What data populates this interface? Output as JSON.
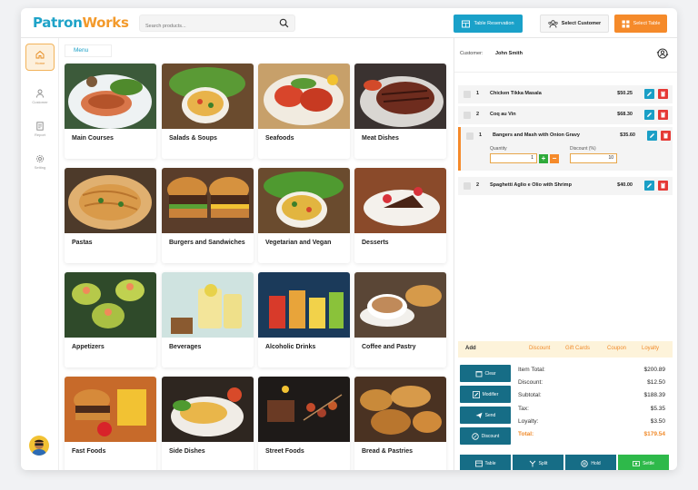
{
  "brand": {
    "part1": "Patron",
    "part2": "Works",
    "accent": "#1fa3c8",
    "accent2": "#f39a2b"
  },
  "search": {
    "placeholder": "Search products..."
  },
  "header": {
    "table_reservation": "Table Reservation",
    "select_customer": "Select Customer",
    "select_table": "Select Table"
  },
  "sidebar": {
    "items": [
      {
        "label": "Home",
        "icon": "home-icon",
        "active": true
      },
      {
        "label": "Customer",
        "icon": "user-icon"
      },
      {
        "label": "Report",
        "icon": "report-icon"
      },
      {
        "label": "Setting",
        "icon": "gear-icon"
      }
    ]
  },
  "menu_tab": "Menu",
  "categories": [
    {
      "label": "Main Courses"
    },
    {
      "label": "Salads & Soups"
    },
    {
      "label": "Seafoods"
    },
    {
      "label": "Meat Dishes"
    },
    {
      "label": "Pastas"
    },
    {
      "label": "Burgers and Sandwiches"
    },
    {
      "label": "Vegetarian and Vegan"
    },
    {
      "label": "Desserts"
    },
    {
      "label": "Appetizers"
    },
    {
      "label": "Beverages"
    },
    {
      "label": "Alcoholic Drinks"
    },
    {
      "label": "Coffee and Pastry"
    },
    {
      "label": "Fast Foods"
    },
    {
      "label": "Side Dishes"
    },
    {
      "label": "Street Foods"
    },
    {
      "label": "Bread & Pastries"
    }
  ],
  "order": {
    "customer_label": "Customer:",
    "customer_name": "John Smith",
    "items": [
      {
        "qty": "1",
        "name": "Chicken Tikka Masala",
        "price": "$50.25"
      },
      {
        "qty": "2",
        "name": "Coq au Vin",
        "price": "$68.30"
      },
      {
        "qty": "1",
        "name": "Bangers and Mash with Onion Gravy",
        "price": "$35.60",
        "quantity_label": "Quantity",
        "quantity": "1",
        "discount_label": "Discount (%)",
        "discount": "10"
      },
      {
        "qty": "2",
        "name": "Spaghetti Aglio e Olio with Shrimp",
        "price": "$40.00"
      }
    ],
    "add_bar": {
      "add": "Add",
      "discount": "Discount",
      "gift": "Gift Cards",
      "coupon": "Coupon",
      "loyalty": "Loyalty"
    },
    "actions": [
      "Clear",
      "Modifier",
      "Send",
      "Discount"
    ],
    "summary": [
      {
        "label": "Item Total:",
        "value": "$200.89"
      },
      {
        "label": "Discount:",
        "value": "$12.50"
      },
      {
        "label": "Subtotal:",
        "value": "$188.39"
      },
      {
        "label": "Tax:",
        "value": "$5.35"
      },
      {
        "label": "Loyalty:",
        "value": "$3.50"
      },
      {
        "label": "Total:",
        "value": "$179.54"
      }
    ],
    "bottom": [
      "Table",
      "Split",
      "Hold",
      "Settle"
    ]
  }
}
